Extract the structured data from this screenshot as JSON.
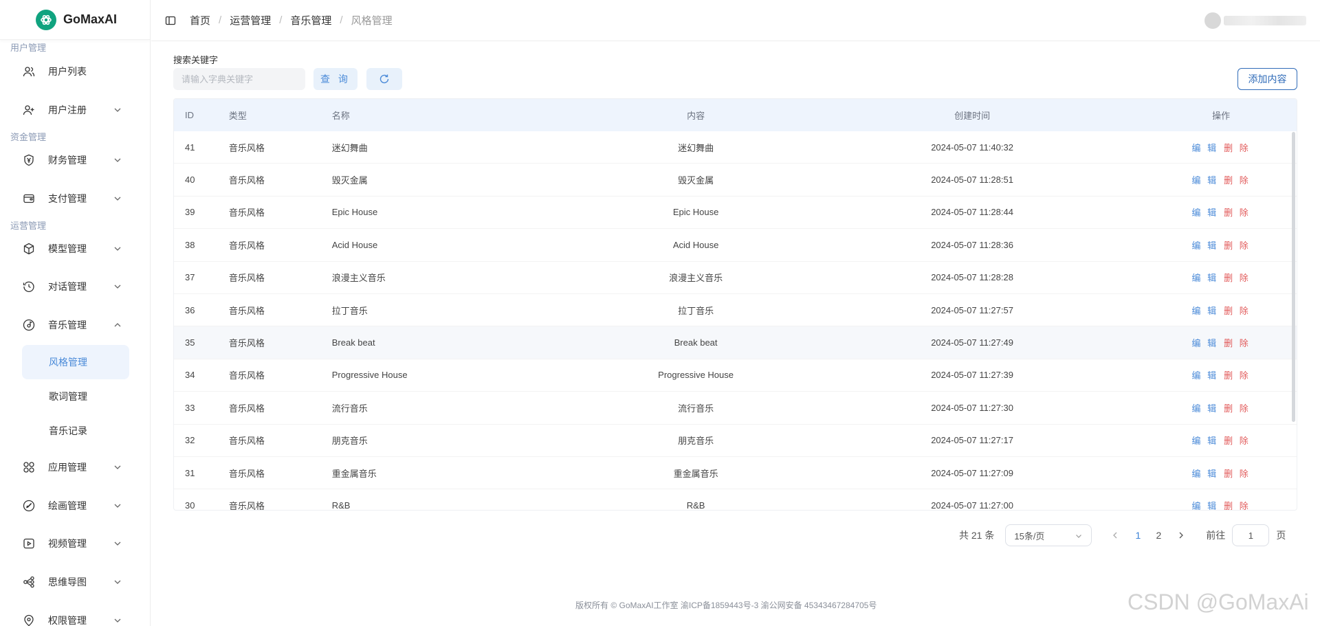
{
  "app": {
    "name": "GoMaxAI"
  },
  "sidebar": {
    "groups": [
      "用户管理",
      "资金管理",
      "运营管理"
    ],
    "items": [
      {
        "label": "用户列表"
      },
      {
        "label": "用户注册"
      },
      {
        "label": "财务管理"
      },
      {
        "label": "支付管理"
      },
      {
        "label": "模型管理"
      },
      {
        "label": "对话管理"
      },
      {
        "label": "音乐管理"
      },
      {
        "label": "应用管理"
      },
      {
        "label": "绘画管理"
      },
      {
        "label": "视频管理"
      },
      {
        "label": "思维导图"
      },
      {
        "label": "权限管理"
      }
    ],
    "music_sub": [
      "风格管理",
      "歌词管理",
      "音乐记录"
    ]
  },
  "header": {
    "breadcrumb": [
      "首页",
      "运营管理",
      "音乐管理",
      "风格管理"
    ]
  },
  "search": {
    "label": "搜索关键字",
    "placeholder": "请输入字典关键字",
    "query_label": "查 询",
    "add_label": "添加内容"
  },
  "table": {
    "columns": [
      "ID",
      "类型",
      "名称",
      "内容",
      "创建时间",
      "操作"
    ],
    "edit_label": "编 辑",
    "delete_label": "删 除",
    "rows": [
      {
        "id": "41",
        "type": "音乐风格",
        "name": "迷幻舞曲",
        "content": "迷幻舞曲",
        "time": "2024-05-07 11:40:32"
      },
      {
        "id": "40",
        "type": "音乐风格",
        "name": "毁灭金属",
        "content": "毁灭金属",
        "time": "2024-05-07 11:28:51"
      },
      {
        "id": "39",
        "type": "音乐风格",
        "name": "Epic House",
        "content": "Epic House",
        "time": "2024-05-07 11:28:44"
      },
      {
        "id": "38",
        "type": "音乐风格",
        "name": "Acid House",
        "content": "Acid House",
        "time": "2024-05-07 11:28:36"
      },
      {
        "id": "37",
        "type": "音乐风格",
        "name": "浪漫主义音乐",
        "content": "浪漫主义音乐",
        "time": "2024-05-07 11:28:28"
      },
      {
        "id": "36",
        "type": "音乐风格",
        "name": "拉丁音乐",
        "content": "拉丁音乐",
        "time": "2024-05-07 11:27:57"
      },
      {
        "id": "35",
        "type": "音乐风格",
        "name": "Break beat",
        "content": "Break beat",
        "time": "2024-05-07 11:27:49"
      },
      {
        "id": "34",
        "type": "音乐风格",
        "name": "Progressive House",
        "content": "Progressive House",
        "time": "2024-05-07 11:27:39"
      },
      {
        "id": "33",
        "type": "音乐风格",
        "name": "流行音乐",
        "content": "流行音乐",
        "time": "2024-05-07 11:27:30"
      },
      {
        "id": "32",
        "type": "音乐风格",
        "name": "朋克音乐",
        "content": "朋克音乐",
        "time": "2024-05-07 11:27:17"
      },
      {
        "id": "31",
        "type": "音乐风格",
        "name": "重金属音乐",
        "content": "重金属音乐",
        "time": "2024-05-07 11:27:09"
      },
      {
        "id": "30",
        "type": "音乐风格",
        "name": "R&B",
        "content": "R&B",
        "time": "2024-05-07 11:27:00"
      }
    ]
  },
  "pagination": {
    "total": "共 21 条",
    "page_size": "15条/页",
    "pages": [
      "1",
      "2"
    ],
    "goto_label": "前往",
    "current": "1",
    "page_suffix": "页"
  },
  "footer": {
    "text": "版权所有 © GoMaxAI工作室   渝ICP备1859443号-3   渝公网安备 45343467284705号"
  },
  "watermark": "CSDN @GoMaxAi",
  "colors": {
    "brand": "#10a37f",
    "accent": "#4a8ad8",
    "danger": "#e25b5b",
    "active_bg": "#eef4fd"
  }
}
